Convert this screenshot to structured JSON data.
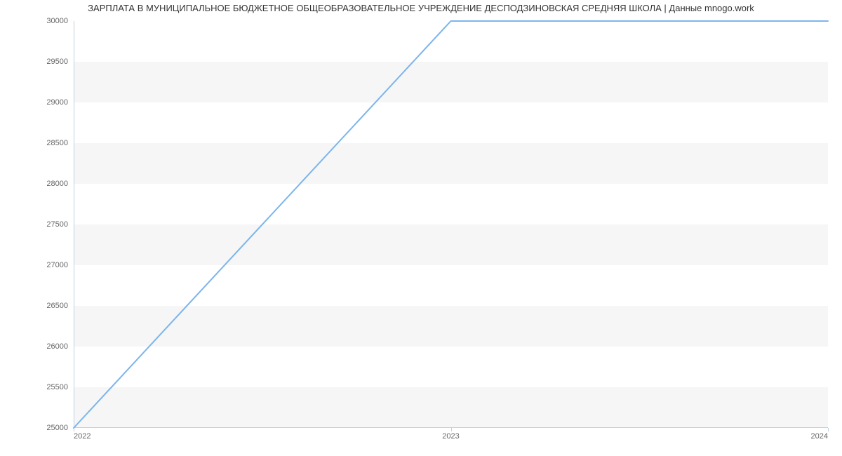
{
  "chart_data": {
    "type": "line",
    "title": "ЗАРПЛАТА В МУНИЦИПАЛЬНОЕ БЮДЖЕТНОЕ ОБЩЕОБРАЗОВАТЕЛЬНОЕ УЧРЕЖДЕНИЕ ДЕСПОДЗИНОВСКАЯ СРЕДНЯЯ ШКОЛА | Данные mnogo.work",
    "x": [
      2022,
      2023,
      2024
    ],
    "values": [
      25000,
      30000,
      30000
    ],
    "x_ticks": [
      2022,
      2023,
      2024
    ],
    "y_ticks": [
      25000,
      25500,
      26000,
      26500,
      27000,
      27500,
      28000,
      28500,
      29000,
      29500,
      30000
    ],
    "xlabel": "",
    "ylabel": "",
    "xlim": [
      2022,
      2024
    ],
    "ylim": [
      25000,
      30000
    ],
    "series_color": "#7cb5ec",
    "band_color": "#f6f6f6"
  },
  "x_tick_labels": {
    "0": "2022",
    "1": "2023",
    "2": "2024"
  },
  "y_tick_labels": {
    "0": "25000",
    "1": "25500",
    "2": "26000",
    "3": "26500",
    "4": "27000",
    "5": "27500",
    "6": "28000",
    "7": "28500",
    "8": "29000",
    "9": "29500",
    "10": "30000"
  }
}
